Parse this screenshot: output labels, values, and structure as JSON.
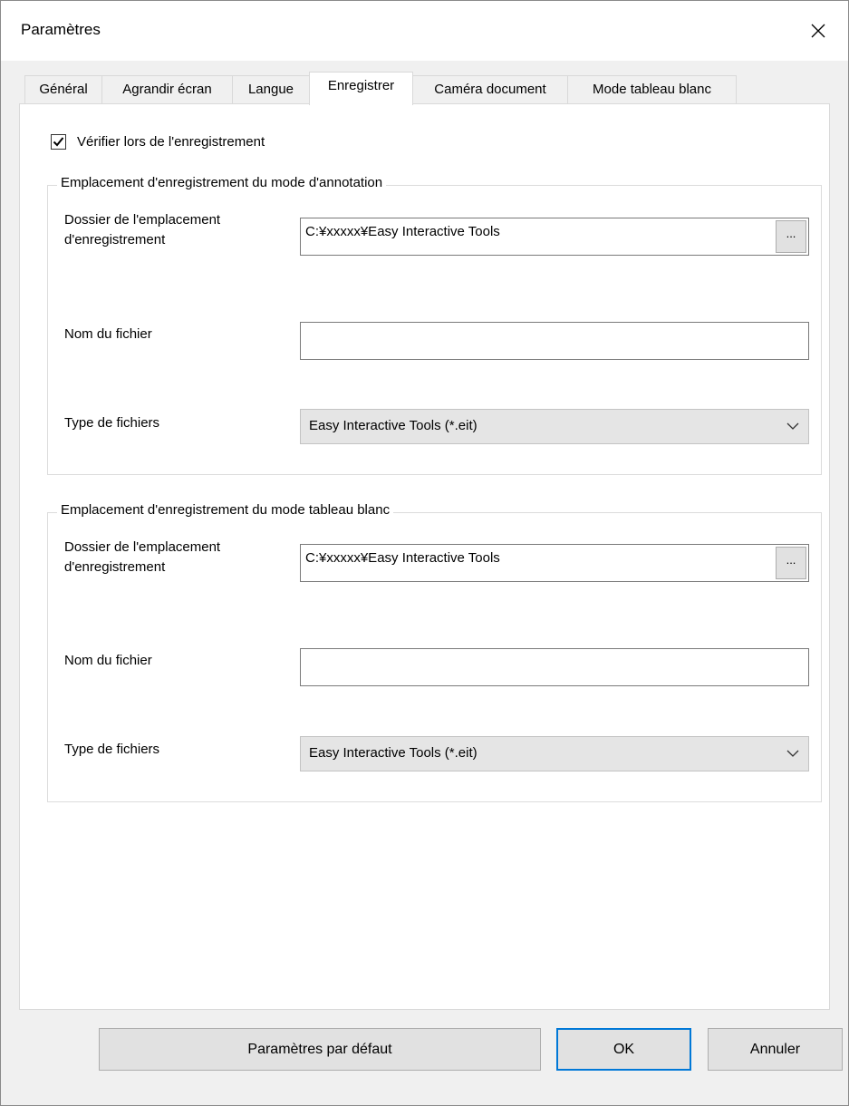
{
  "window": {
    "title": "Paramètres"
  },
  "tabs": [
    {
      "label": "Général"
    },
    {
      "label": "Agrandir écran"
    },
    {
      "label": "Langue"
    },
    {
      "label": "Enregistrer"
    },
    {
      "label": "Caméra document"
    },
    {
      "label": "Mode tableau blanc"
    }
  ],
  "active_tab": "Enregistrer",
  "check_on_save": {
    "label": "Vérifier lors de l'enregistrement",
    "checked": true
  },
  "annotation_group": {
    "legend": "Emplacement d'enregistrement du mode d'annotation",
    "folder_label_line1": "Dossier de l'emplacement",
    "folder_label_line2": "d'enregistrement",
    "folder_value": "C:¥xxxxx¥Easy Interactive Tools",
    "browse_label": "...",
    "filename_label": "Nom du fichier",
    "filename_value": "",
    "filetype_label": "Type de fichiers",
    "filetype_value": "Easy Interactive Tools (*.eit)"
  },
  "whiteboard_group": {
    "legend": "Emplacement d'enregistrement du mode tableau blanc",
    "folder_label_line1": "Dossier de l'emplacement",
    "folder_label_line2": "d'enregistrement",
    "folder_value": "C:¥xxxxx¥Easy Interactive Tools",
    "browse_label": "...",
    "filename_label": "Nom du fichier",
    "filename_value": "",
    "filetype_label": "Type de fichiers",
    "filetype_value": "Easy Interactive Tools (*.eit)"
  },
  "buttons": {
    "defaults": "Paramètres par défaut",
    "ok": "OK",
    "cancel": "Annuler"
  },
  "colors": {
    "accent": "#0078d7",
    "background": "#f0f0f0",
    "panel": "#ffffff"
  },
  "icons": {
    "close": "close-icon",
    "checkbox": "check-icon",
    "dropdown": "chevron-down-icon"
  }
}
